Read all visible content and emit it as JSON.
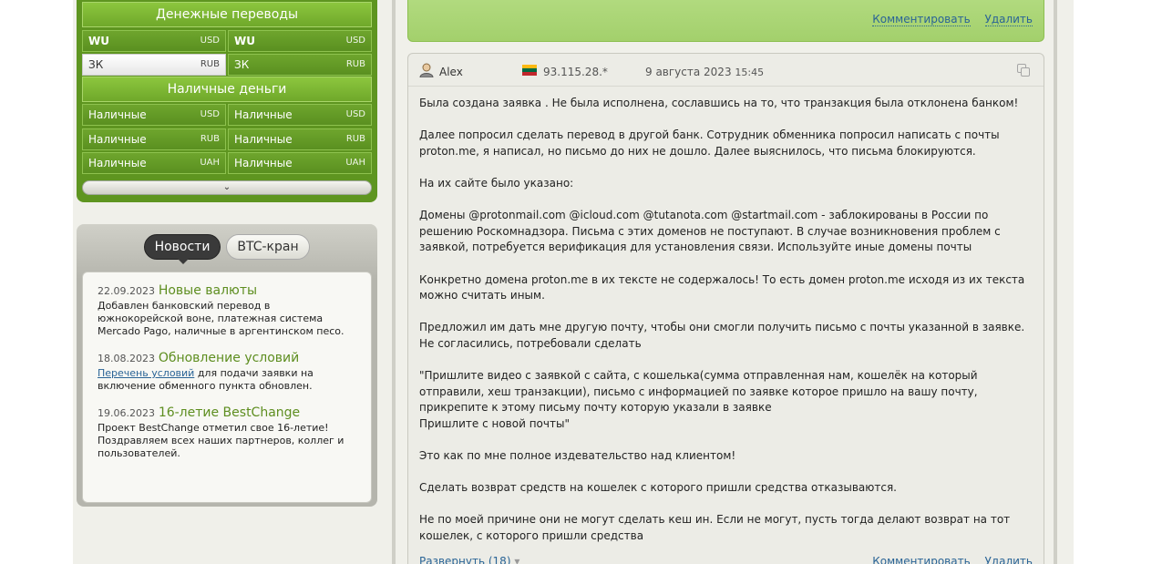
{
  "exchange": {
    "transfers_header": "Денежные переводы",
    "cash_header": "Наличные деньги",
    "transfer_rows": [
      [
        {
          "name": "WU",
          "code": "USD"
        },
        {
          "name": "WU",
          "code": "USD"
        }
      ],
      [
        {
          "name": "ЗК",
          "code": "RUB"
        },
        {
          "name": "ЗК",
          "code": "RUB"
        }
      ]
    ],
    "cash_rows": [
      [
        {
          "name": "Наличные",
          "code": "USD"
        },
        {
          "name": "Наличные",
          "code": "USD"
        }
      ],
      [
        {
          "name": "Наличные",
          "code": "RUB"
        },
        {
          "name": "Наличные",
          "code": "RUB"
        }
      ],
      [
        {
          "name": "Наличные",
          "code": "UAH"
        },
        {
          "name": "Наличные",
          "code": "UAH"
        }
      ]
    ],
    "expand_glyph": "⌄"
  },
  "news": {
    "tab_news": "Новости",
    "tab_btc": "BTC-кран",
    "items": [
      {
        "date": "22.09.2023",
        "title": "Новые валюты",
        "text": "Добавлен банковский перевод в южнокорейской воне, платежная система Mercado Pago, наличные в аргентинском песо."
      },
      {
        "date": "18.08.2023",
        "title": "Обновление условий",
        "link": "Перечень условий",
        "text": " для подачи заявки на включение обменного пункта обновлен."
      },
      {
        "date": "19.06.2023",
        "title": "16-летие BestChange",
        "text": "Проект BestChange отметил свое 16-летие! Поздравляем всех наших партнеров, коллег и пользователей."
      }
    ]
  },
  "prev_comment": {
    "comment_label": "Комментировать",
    "delete_label": "Удалить"
  },
  "comment": {
    "author": "Alex",
    "ip": "93.115.28.*",
    "date": "9 августа 2023",
    "time": "15:45",
    "paragraphs": [
      "Была создана заявка . Не была исполнена, сославшись на то, что транзакция была отклонена банком!",
      "Далее попросил сделать перевод в другой банк. Сотрудник обменника попросил написать с почты proton.me, я написал, но письмо до них не дошло. Далее выяснилось, что письма блокируются.",
      "На их сайте было указано:",
      "Домены @protonmail.com @icloud.com @tutanota.com @startmail.com - заблокированы в России по решению Роскомнадзора. Письма с этих доменов не поступают. В случае возникновения проблем с заявкой, потребуется верификация для установления связи. Используйте иные домены почты",
      "Конкретно домена proton.me в их тексте не содержалось! То есть домен proton.me исходя из их текста можно считать иным.",
      "Предложил им дать мне другую почту, чтобы они смогли получить письмо с почты указанной в заявке. Не согласились, потребовали сделать",
      "\"Пришлите видео с заявкой с сайта, с кошелька(сумма отправленная нам, кошелёк на который отправили, хеш транзакции), письмо с информацией по заявке которое пришло на вашу почту, прикрепите к этому письму почту которую указали в заявке\nПришлите с новой почты\"",
      "Это как по мне полное издевательство над клиентом!",
      "Сделать возврат средств на кошелек с которого пришли средства отказываются.",
      "Не по моей причине они не могут сделать кеш ин. Если не могут, пусть тогда делают возврат на тот кошелек, с которого пришли средства"
    ],
    "expand_label": "Развернуть (18)",
    "expand_arrow": "▾",
    "comment_label": "Комментировать",
    "delete_label": "Удалить"
  },
  "colors": {
    "accent_green": "#5e9520",
    "link_blue": "#2a6496"
  }
}
